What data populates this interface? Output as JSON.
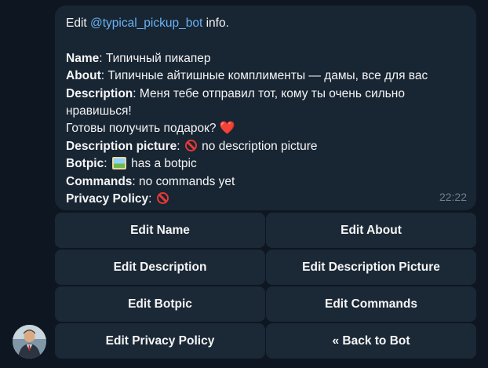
{
  "message": {
    "edit_prefix": "Edit ",
    "bot_username": "@typical_pickup_bot",
    "edit_suffix": " info.",
    "name_label": "Name",
    "name_value": ": Типичный пикапер",
    "about_label": "About",
    "about_value": ": Типичные айтишные комплименты — дамы, все для вас",
    "description_label": "Description",
    "description_value_1": ": Меня тебе отправил тот, кому ты очень сильно",
    "description_value_2": "нравишься!",
    "description_value_3": "Готовы получить подарок? ",
    "description_emoji": "❤️",
    "description_picture_label": "Description picture",
    "description_picture_value": " no description picture",
    "botpic_label": "Botpic",
    "botpic_value": " has a botpic",
    "commands_label": "Commands",
    "commands_value": ": no commands yet",
    "privacy_label": "Privacy Policy",
    "privacy_value": ": ",
    "time": "22:22",
    "icons": {
      "no_entry": "no-entry-icon",
      "picture": "framed-picture-icon",
      "heart": "red-heart"
    }
  },
  "keyboard": {
    "buttons": [
      "Edit Name",
      "Edit About",
      "Edit Description",
      "Edit Description Picture",
      "Edit Botpic",
      "Edit Commands",
      "Edit Privacy Policy",
      "« Back to Bot"
    ]
  },
  "colors": {
    "background": "#0e1621",
    "bubble": "#182533",
    "button": "#1b2836",
    "link": "#6ab3f3",
    "time": "#6d7f8f"
  }
}
